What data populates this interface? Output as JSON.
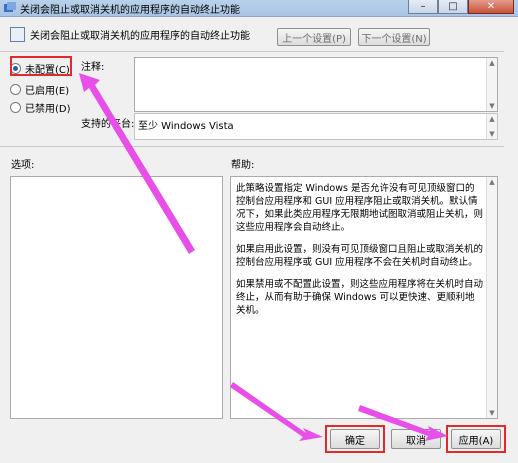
{
  "window": {
    "title": "关闭会阻止或取消关机的应用程序的自动终止功能"
  },
  "header": {
    "setting_name": "关闭会阻止或取消关机的应用程序的自动终止功能",
    "prev_button": "上一个设置(P)",
    "next_button": "下一个设置(N)"
  },
  "options": {
    "not_configured": "未配置(C)",
    "enabled": "已启用(E)",
    "disabled": "已禁用(D)",
    "selected": "not_configured"
  },
  "comment": {
    "label": "注释:",
    "value": ""
  },
  "supported": {
    "label": "支持的平台:",
    "value": "至少 Windows Vista"
  },
  "options_section": {
    "label": "选项:"
  },
  "help": {
    "label": "帮助:",
    "p1": "此策略设置指定 Windows 是否允许没有可见顶级窗口的控制台应用程序和 GUI 应用程序阻止或取消关机。默认情况下，如果此类应用程序无限期地试图取消或阻止关机，则这些应用程序会自动终止。",
    "p2": "如果启用此设置，则没有可见顶级窗口且阻止或取消关机的控制台应用程序或 GUI 应用程序不会在关机时自动终止。",
    "p3": "如果禁用或不配置此设置，则这些应用程序将在关机时自动终止，从而有助于确保 Windows 可以更快速、更顺利地关机。"
  },
  "footer": {
    "ok": "确定",
    "cancel": "取消",
    "apply": "应用(A)"
  },
  "colors": {
    "annotation_arrow": "#e84ee8",
    "highlight_frame": "#e02b2b"
  }
}
